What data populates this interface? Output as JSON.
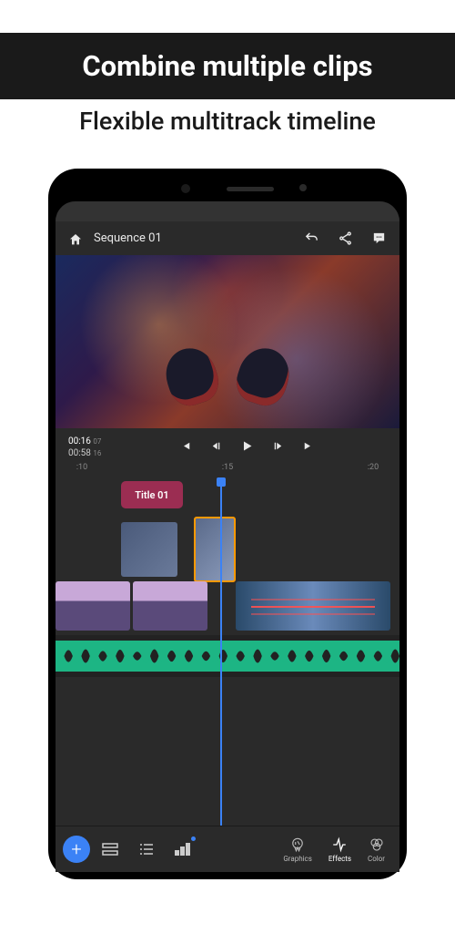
{
  "headline": "Combine multiple clips",
  "subheadline": "Flexible multitrack timeline",
  "topbar": {
    "title": "Sequence 01"
  },
  "timecode": {
    "current": "00:16",
    "cur_frame": "07",
    "total": "00:58",
    "tot_frame": "16"
  },
  "ruler": {
    "t1": ":10",
    "t2": ":15",
    "t3": ":20"
  },
  "title_clip": {
    "label": "Title 01"
  },
  "bottombar": {
    "graphics": "Graphics",
    "effects": "Effects",
    "color": "Color"
  }
}
